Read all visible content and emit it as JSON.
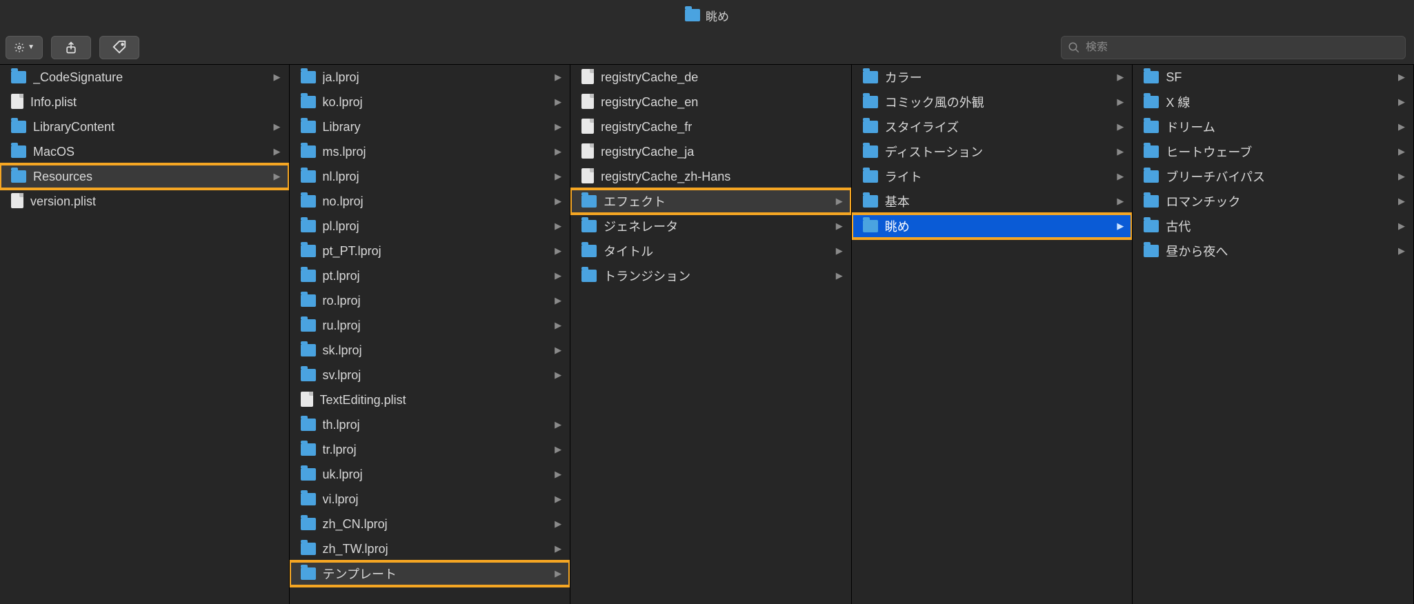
{
  "window": {
    "title": "眺め"
  },
  "search": {
    "placeholder": "検索"
  },
  "columns": [
    {
      "items": [
        {
          "kind": "folder",
          "label": "_CodeSignature",
          "hasChildren": true
        },
        {
          "kind": "file",
          "label": "Info.plist"
        },
        {
          "kind": "folder",
          "label": "LibraryContent",
          "hasChildren": true
        },
        {
          "kind": "folder",
          "label": "MacOS",
          "hasChildren": true
        },
        {
          "kind": "folder",
          "label": "Resources",
          "hasChildren": true,
          "selected": true,
          "highlight": true
        },
        {
          "kind": "file",
          "label": "version.plist"
        }
      ]
    },
    {
      "items": [
        {
          "kind": "folder",
          "label": "ja.lproj",
          "hasChildren": true
        },
        {
          "kind": "folder",
          "label": "ko.lproj",
          "hasChildren": true
        },
        {
          "kind": "folder",
          "label": "Library",
          "hasChildren": true
        },
        {
          "kind": "folder",
          "label": "ms.lproj",
          "hasChildren": true
        },
        {
          "kind": "folder",
          "label": "nl.lproj",
          "hasChildren": true
        },
        {
          "kind": "folder",
          "label": "no.lproj",
          "hasChildren": true
        },
        {
          "kind": "folder",
          "label": "pl.lproj",
          "hasChildren": true
        },
        {
          "kind": "folder",
          "label": "pt_PT.lproj",
          "hasChildren": true
        },
        {
          "kind": "folder",
          "label": "pt.lproj",
          "hasChildren": true
        },
        {
          "kind": "folder",
          "label": "ro.lproj",
          "hasChildren": true
        },
        {
          "kind": "folder",
          "label": "ru.lproj",
          "hasChildren": true
        },
        {
          "kind": "folder",
          "label": "sk.lproj",
          "hasChildren": true
        },
        {
          "kind": "folder",
          "label": "sv.lproj",
          "hasChildren": true
        },
        {
          "kind": "file",
          "label": "TextEditing.plist"
        },
        {
          "kind": "folder",
          "label": "th.lproj",
          "hasChildren": true
        },
        {
          "kind": "folder",
          "label": "tr.lproj",
          "hasChildren": true
        },
        {
          "kind": "folder",
          "label": "uk.lproj",
          "hasChildren": true
        },
        {
          "kind": "folder",
          "label": "vi.lproj",
          "hasChildren": true
        },
        {
          "kind": "folder",
          "label": "zh_CN.lproj",
          "hasChildren": true
        },
        {
          "kind": "folder",
          "label": "zh_TW.lproj",
          "hasChildren": true
        },
        {
          "kind": "folder",
          "label": "テンプレート",
          "hasChildren": true,
          "selected": true,
          "highlight": true
        }
      ]
    },
    {
      "items": [
        {
          "kind": "file",
          "label": "registryCache_de"
        },
        {
          "kind": "file",
          "label": "registryCache_en"
        },
        {
          "kind": "file",
          "label": "registryCache_fr"
        },
        {
          "kind": "file",
          "label": "registryCache_ja"
        },
        {
          "kind": "file",
          "label": "registryCache_zh-Hans"
        },
        {
          "kind": "folder",
          "label": "エフェクト",
          "hasChildren": true,
          "selected": true,
          "highlight": true
        },
        {
          "kind": "folder",
          "label": "ジェネレータ",
          "hasChildren": true
        },
        {
          "kind": "folder",
          "label": "タイトル",
          "hasChildren": true
        },
        {
          "kind": "folder",
          "label": "トランジション",
          "hasChildren": true
        }
      ]
    },
    {
      "items": [
        {
          "kind": "folder",
          "label": "カラー",
          "hasChildren": true
        },
        {
          "kind": "folder",
          "label": "コミック風の外観",
          "hasChildren": true
        },
        {
          "kind": "folder",
          "label": "スタイライズ",
          "hasChildren": true
        },
        {
          "kind": "folder",
          "label": "ディストーション",
          "hasChildren": true
        },
        {
          "kind": "folder",
          "label": "ライト",
          "hasChildren": true
        },
        {
          "kind": "folder",
          "label": "基本",
          "hasChildren": true
        },
        {
          "kind": "folder",
          "label": "眺め",
          "hasChildren": true,
          "active": true,
          "highlight": true
        }
      ]
    },
    {
      "items": [
        {
          "kind": "folder",
          "label": "SF",
          "hasChildren": true
        },
        {
          "kind": "folder",
          "label": "X 線",
          "hasChildren": true
        },
        {
          "kind": "folder",
          "label": "ドリーム",
          "hasChildren": true
        },
        {
          "kind": "folder",
          "label": "ヒートウェーブ",
          "hasChildren": true
        },
        {
          "kind": "folder",
          "label": "ブリーチバイパス",
          "hasChildren": true
        },
        {
          "kind": "folder",
          "label": "ロマンチック",
          "hasChildren": true
        },
        {
          "kind": "folder",
          "label": "古代",
          "hasChildren": true
        },
        {
          "kind": "folder",
          "label": "昼から夜へ",
          "hasChildren": true
        }
      ]
    }
  ]
}
